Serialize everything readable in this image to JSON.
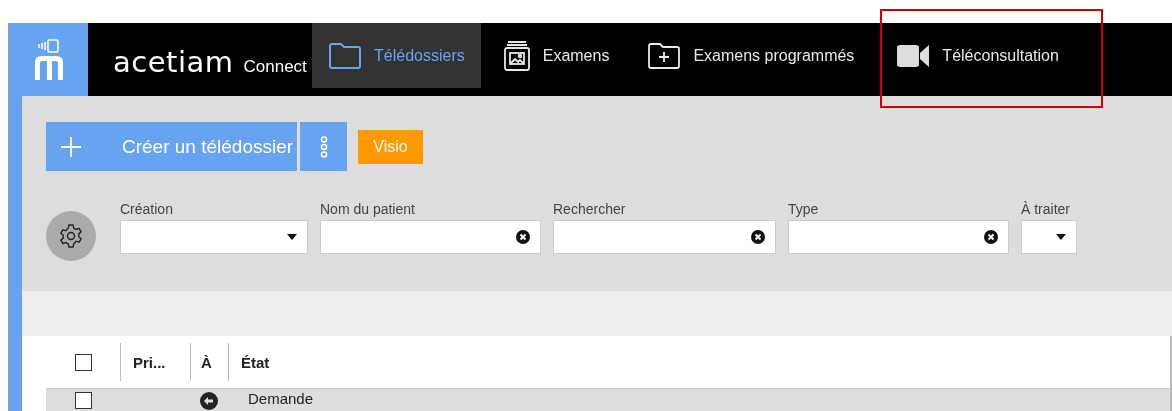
{
  "brand": {
    "name": "acetiam",
    "product": "Connect"
  },
  "nav": [
    {
      "label": "Télédossiers",
      "kind": "folder",
      "selected": true,
      "highlighted": false
    },
    {
      "label": "Examens",
      "kind": "images",
      "selected": false,
      "highlighted": false
    },
    {
      "label": "Examens programmés",
      "kind": "scheduled",
      "selected": false,
      "highlighted": false
    },
    {
      "label": "Téléconsultation",
      "kind": "video",
      "selected": false,
      "highlighted": true
    }
  ],
  "actions": {
    "create": "Créer un télédossier",
    "visio": "Visio"
  },
  "filters": [
    {
      "label": "Création",
      "kind": "select"
    },
    {
      "label": "Nom du patient",
      "kind": "clearable"
    },
    {
      "label": "Rechercher",
      "kind": "clearable"
    },
    {
      "label": "Type",
      "kind": "clearable"
    },
    {
      "label": "À traiter",
      "kind": "select"
    }
  ],
  "table": {
    "columns": [
      "Pri...",
      "À",
      "État"
    ],
    "rows": [
      {
        "checked": false,
        "status": "Demande"
      }
    ]
  },
  "header_checkbox": {
    "checked": false
  }
}
